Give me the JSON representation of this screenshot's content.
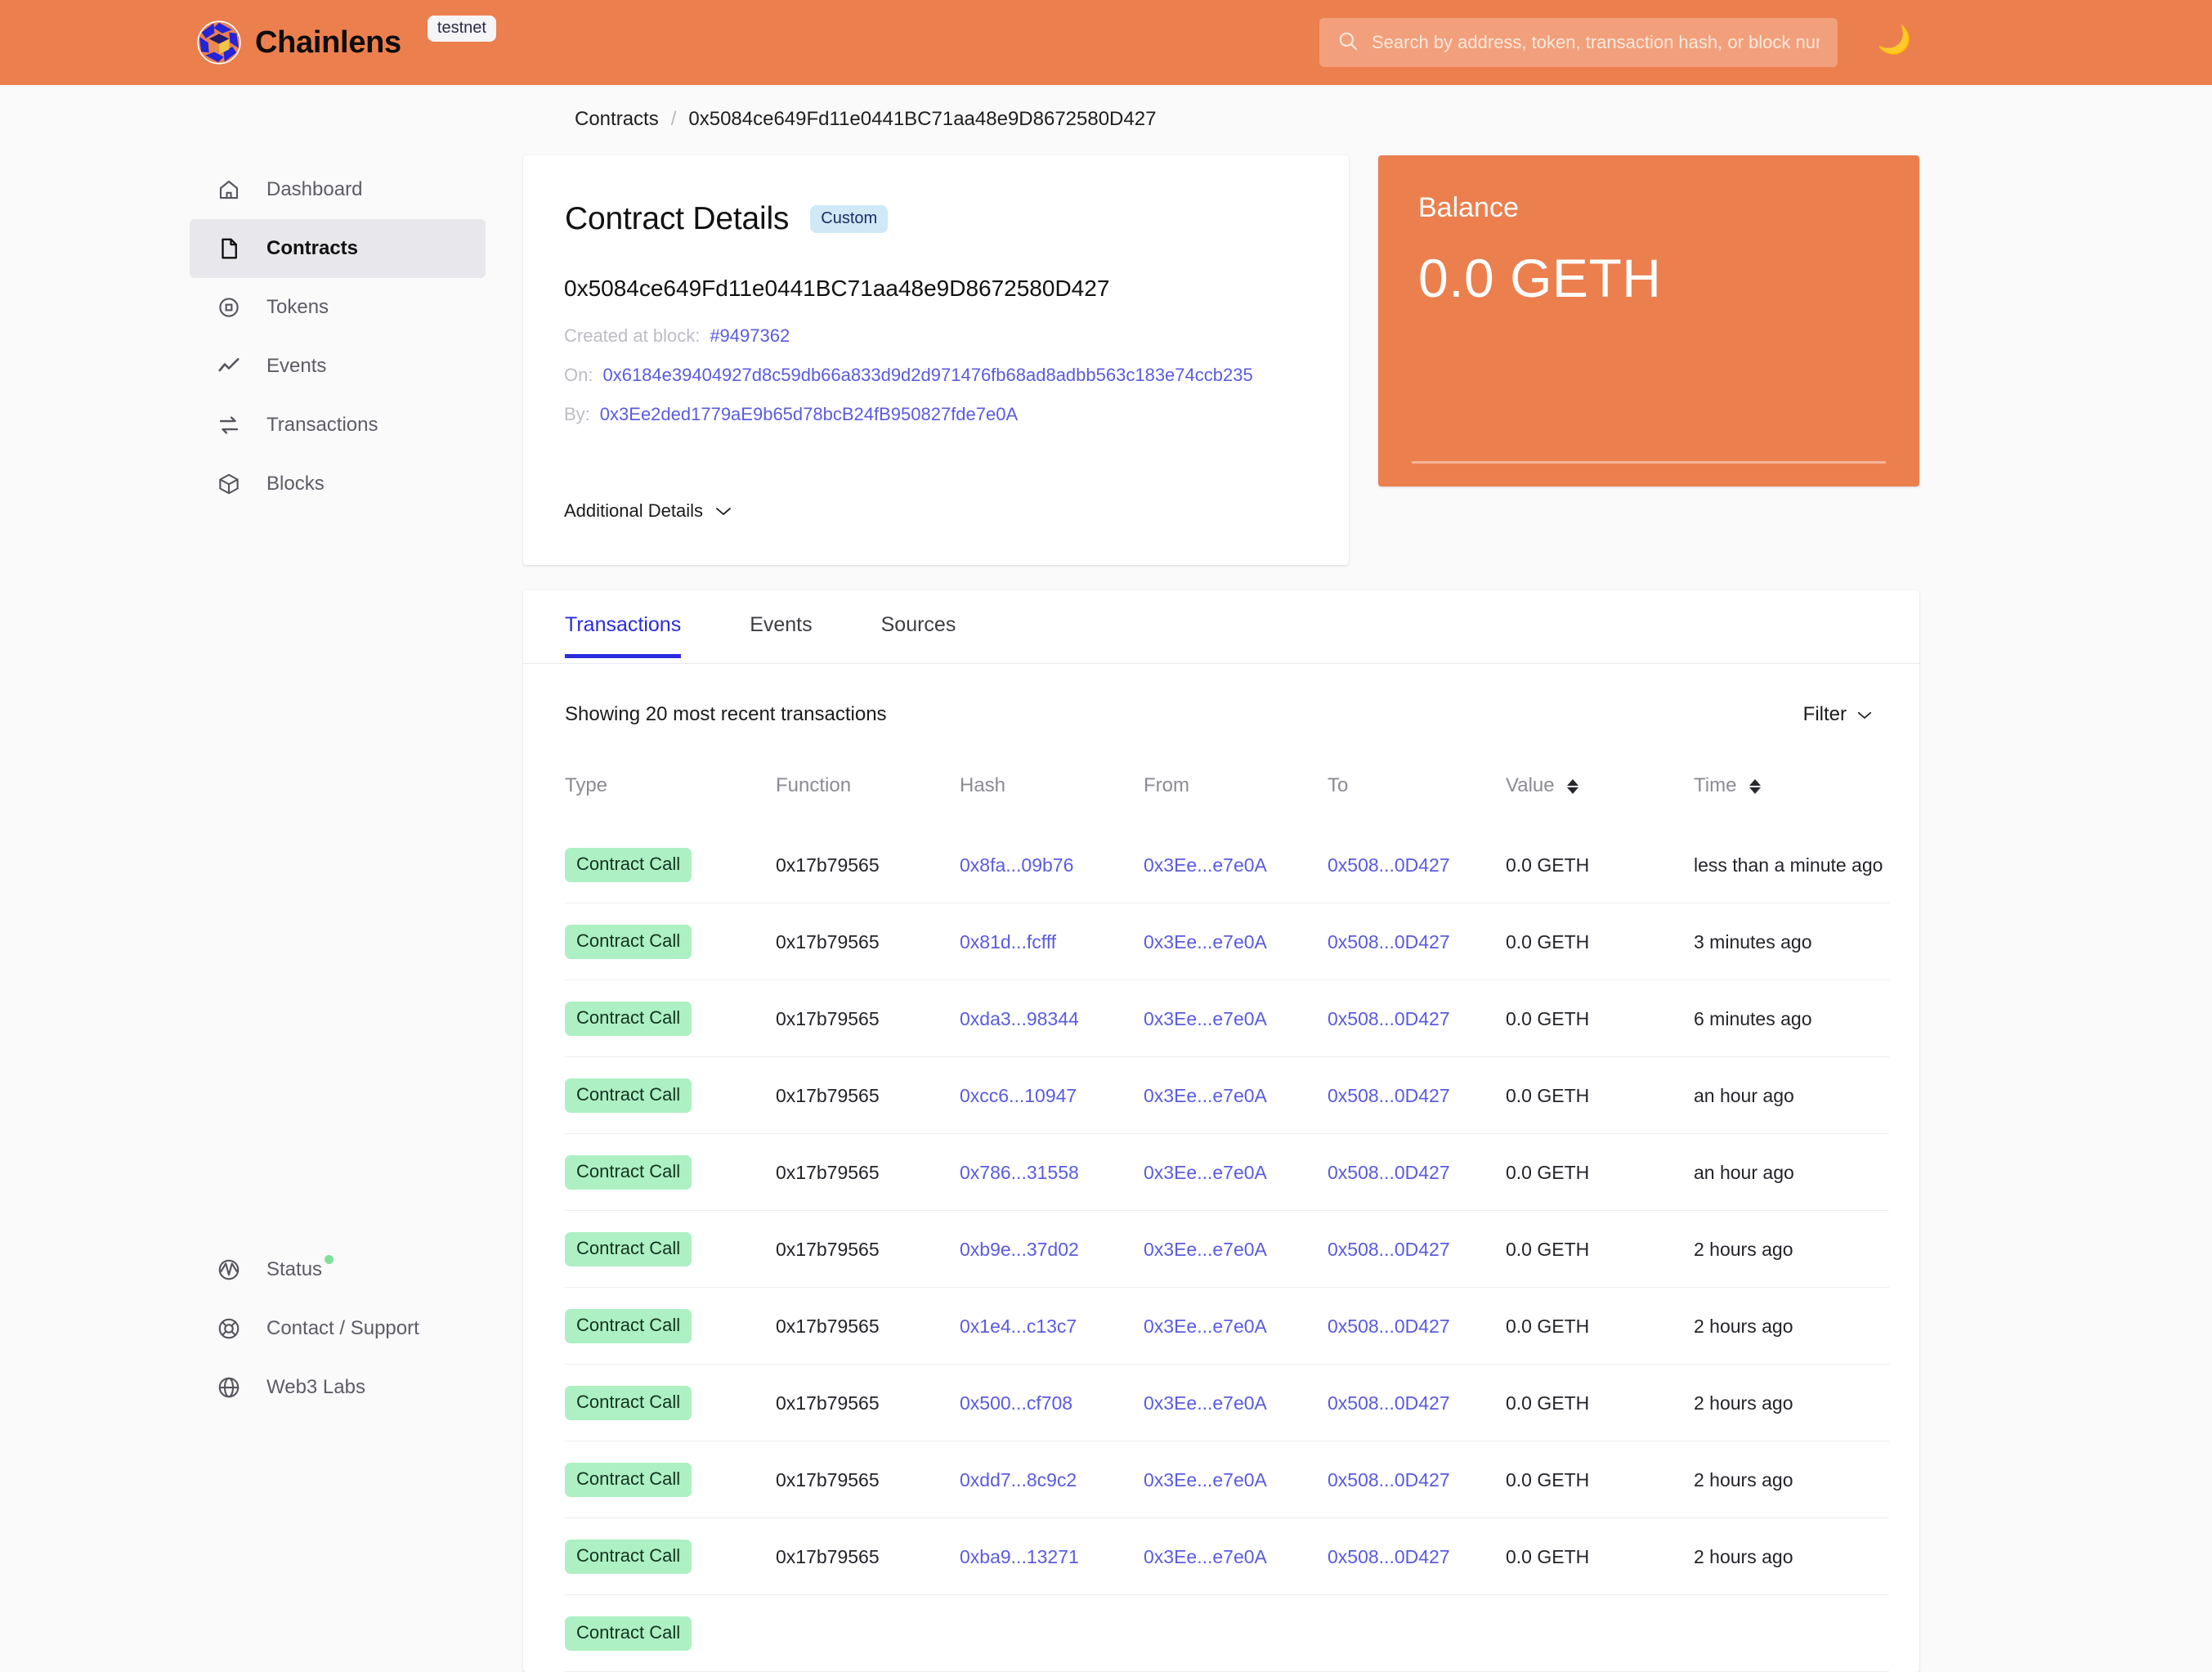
{
  "header": {
    "brand": "Chainlens",
    "network_badge": "testnet",
    "search": {
      "value": "",
      "placeholder": "Search by address, token, transaction hash, or block number"
    },
    "theme_toggle_glyph": "🌙",
    "accent_color": "#ec7f4e"
  },
  "breadcrumb": {
    "parent": "Contracts",
    "separator": "/",
    "current": "0x5084ce649Fd11e0441BC71aa48e9D8672580D427"
  },
  "sidebar": {
    "primary": [
      {
        "label": "Dashboard",
        "icon": "home-icon",
        "active": false
      },
      {
        "label": "Contracts",
        "icon": "document-icon",
        "active": true
      },
      {
        "label": "Tokens",
        "icon": "token-circle-icon",
        "active": false
      },
      {
        "label": "Events",
        "icon": "activity-icon",
        "active": false
      },
      {
        "label": "Transactions",
        "icon": "swap-arrows-icon",
        "active": false
      },
      {
        "label": "Blocks",
        "icon": "cube-icon",
        "active": false
      }
    ],
    "secondary": [
      {
        "label": "Status",
        "icon": "status-gauge-icon",
        "dot": true,
        "dot_color": "#7fe09a"
      },
      {
        "label": "Contact / Support",
        "icon": "lifebuoy-icon",
        "dot": false
      },
      {
        "label": "Web3 Labs",
        "icon": "globe-icon",
        "dot": false
      }
    ]
  },
  "contract_details": {
    "title": "Contract Details",
    "badge": "Custom",
    "address": "0x5084ce649Fd11e0441BC71aa48e9D8672580D427",
    "created_at_block_label": "Created at block:",
    "created_at_block_value": "#9497362",
    "on_label": "On:",
    "on_value": "0x6184e39404927d8c59db66a833d9d2d971476fb68ad8adbb563c183e74ccb235",
    "by_label": "By:",
    "by_value": "0x3Ee2ded1779aE9b65d78bcB24fB950827fde7e0A",
    "additional_details_label": "Additional Details",
    "chevron_glyph": "⌄"
  },
  "balance": {
    "label": "Balance",
    "value": "0.0 GETH"
  },
  "tabs": [
    {
      "label": "Transactions",
      "active": true
    },
    {
      "label": "Events",
      "active": false
    },
    {
      "label": "Sources",
      "active": false
    }
  ],
  "transactions_panel": {
    "showing_text": "Showing 20 most recent transactions",
    "filter_label": "Filter",
    "filter_chevron": "⌄",
    "columns": [
      {
        "key": "type",
        "label": "Type",
        "sortable": false
      },
      {
        "key": "function",
        "label": "Function",
        "sortable": false
      },
      {
        "key": "hash",
        "label": "Hash",
        "sortable": false
      },
      {
        "key": "from",
        "label": "From",
        "sortable": false
      },
      {
        "key": "to",
        "label": "To",
        "sortable": false
      },
      {
        "key": "value",
        "label": "Value",
        "sortable": true
      },
      {
        "key": "time",
        "label": "Time",
        "sortable": true
      }
    ],
    "rows": [
      {
        "type": "Contract Call",
        "function": "0x17b79565",
        "hash": "0x8fa...09b76",
        "from": "0x3Ee...e7e0A",
        "to": "0x508...0D427",
        "value": "0.0 GETH",
        "time": "less than a minute ago"
      },
      {
        "type": "Contract Call",
        "function": "0x17b79565",
        "hash": "0x81d...fcfff",
        "from": "0x3Ee...e7e0A",
        "to": "0x508...0D427",
        "value": "0.0 GETH",
        "time": "3 minutes ago"
      },
      {
        "type": "Contract Call",
        "function": "0x17b79565",
        "hash": "0xda3...98344",
        "from": "0x3Ee...e7e0A",
        "to": "0x508...0D427",
        "value": "0.0 GETH",
        "time": "6 minutes ago"
      },
      {
        "type": "Contract Call",
        "function": "0x17b79565",
        "hash": "0xcc6...10947",
        "from": "0x3Ee...e7e0A",
        "to": "0x508...0D427",
        "value": "0.0 GETH",
        "time": "an hour ago"
      },
      {
        "type": "Contract Call",
        "function": "0x17b79565",
        "hash": "0x786...31558",
        "from": "0x3Ee...e7e0A",
        "to": "0x508...0D427",
        "value": "0.0 GETH",
        "time": "an hour ago"
      },
      {
        "type": "Contract Call",
        "function": "0x17b79565",
        "hash": "0xb9e...37d02",
        "from": "0x3Ee...e7e0A",
        "to": "0x508...0D427",
        "value": "0.0 GETH",
        "time": "2 hours ago"
      },
      {
        "type": "Contract Call",
        "function": "0x17b79565",
        "hash": "0x1e4...c13c7",
        "from": "0x3Ee...e7e0A",
        "to": "0x508...0D427",
        "value": "0.0 GETH",
        "time": "2 hours ago"
      },
      {
        "type": "Contract Call",
        "function": "0x17b79565",
        "hash": "0x500...cf708",
        "from": "0x3Ee...e7e0A",
        "to": "0x508...0D427",
        "value": "0.0 GETH",
        "time": "2 hours ago"
      },
      {
        "type": "Contract Call",
        "function": "0x17b79565",
        "hash": "0xdd7...8c9c2",
        "from": "0x3Ee...e7e0A",
        "to": "0x508...0D427",
        "value": "0.0 GETH",
        "time": "2 hours ago"
      },
      {
        "type": "Contract Call",
        "function": "0x17b79565",
        "hash": "0xba9...13271",
        "from": "0x3Ee...e7e0A",
        "to": "0x508...0D427",
        "value": "0.0 GETH",
        "time": "2 hours ago"
      },
      {
        "type": "Contract Call",
        "function": "",
        "hash": "",
        "from": "",
        "to": "",
        "value": "",
        "time": ""
      }
    ]
  }
}
